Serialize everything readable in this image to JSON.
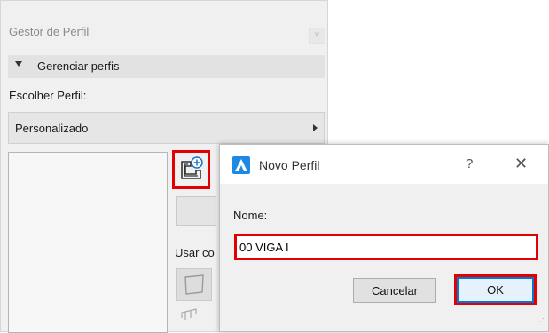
{
  "profile_manager": {
    "title": "Gestor de Perfil",
    "section_label": "Gerenciar perfis",
    "choose_label": "Escolher Perfil:",
    "selected_profile": "Personalizado",
    "use_as_label": "Usar co"
  },
  "dialog": {
    "title": "Novo Perfil",
    "help_label": "?",
    "close_label": "✕",
    "name_label": "Nome:",
    "name_value": "00 VIGA I",
    "cancel_label": "Cancelar",
    "ok_label": "OK"
  },
  "colors": {
    "highlight": "#e30000",
    "default_button_border": "#0078d7"
  }
}
